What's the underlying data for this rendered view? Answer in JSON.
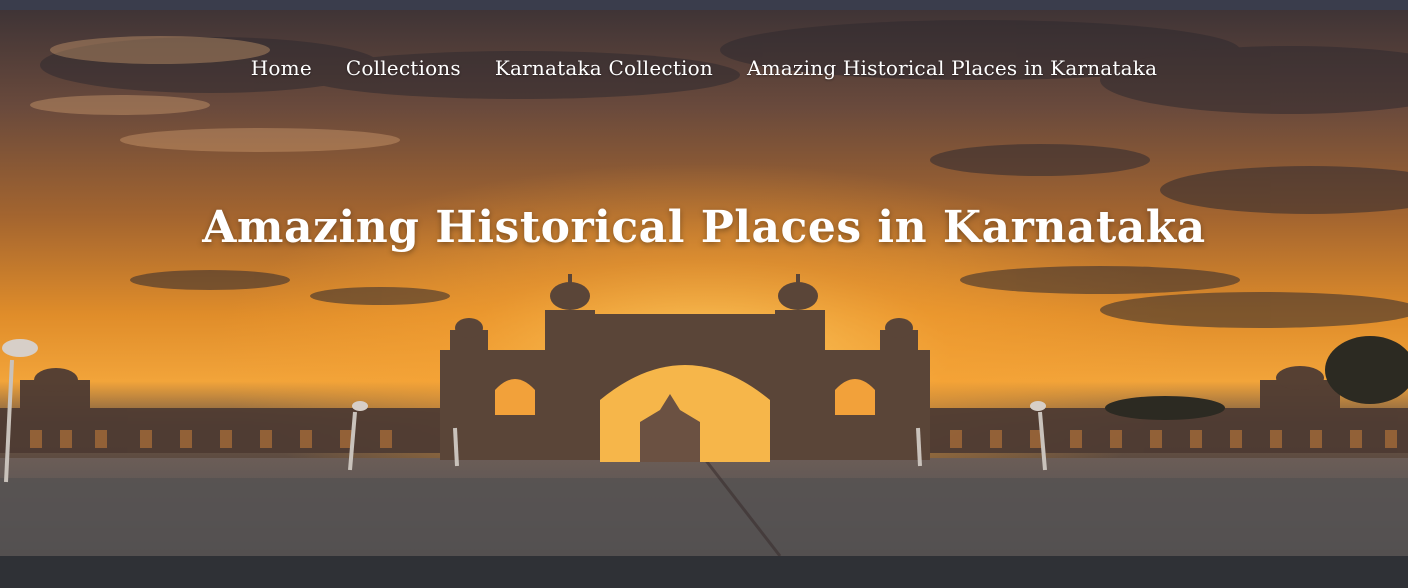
{
  "nav": {
    "items": [
      {
        "label": "Home"
      },
      {
        "label": "Collections"
      },
      {
        "label": "Karnataka Collection"
      },
      {
        "label": "Amazing Historical Places in Karnataka"
      }
    ]
  },
  "hero": {
    "title": "Amazing Historical Places in Karnataka"
  },
  "colors": {
    "topbar": "#3a3d4c",
    "bottombar": "#2f3136",
    "sky_mid": "#d98a2b",
    "sky_top": "#4b3a3a",
    "text": "#ffffff"
  }
}
